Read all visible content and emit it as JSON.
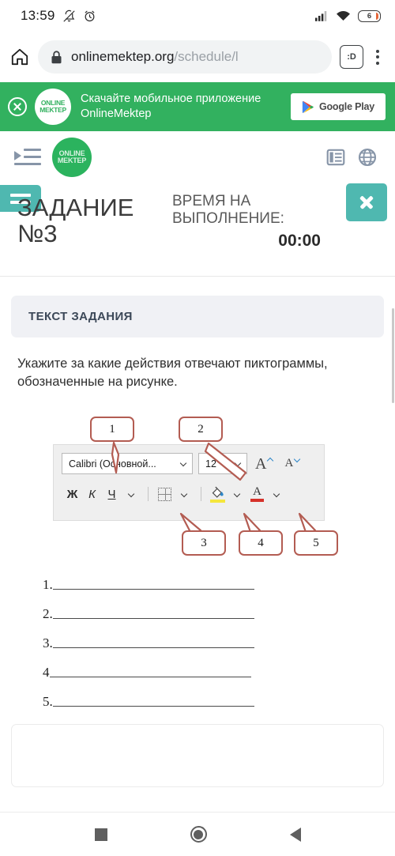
{
  "status_bar": {
    "time": "13:59",
    "icons": [
      "bell-off-icon",
      "alarm-icon",
      "signal-icon",
      "wifi-icon"
    ],
    "battery_level": "6"
  },
  "browser": {
    "home_icon": "home-icon",
    "lock_icon": "lock-icon",
    "url_domain": "onlinemektep.org",
    "url_path": "/schedule/l",
    "dino_label": ":D",
    "menu_icon": "kebab-menu-icon"
  },
  "promo_banner": {
    "close_icon": "close-circle-icon",
    "logo_line1": "ONLINE",
    "logo_line2": "MEKTEP",
    "text_line1": "Скачайте мобильное приложение",
    "text_line2": "OnlineMektep",
    "store_button": "Google Play",
    "bg_color": "#32b15f"
  },
  "site_nav": {
    "toggle_icon": "sidebar-toggle-icon",
    "logo_line1": "ONLINE",
    "logo_line2": "MEKTEP",
    "list_icon": "list-icon",
    "globe_icon": "globe-icon",
    "logo_color": "#2bb35e"
  },
  "task_header": {
    "burger_icon": "hamburger-menu-icon",
    "title_line1": "ЗАДАНИЕ",
    "title_line2": "№3",
    "timer_label_line1": "ВРЕМЯ НА",
    "timer_label_line2": "ВЫПОЛНЕНИЕ:",
    "timer_value": "00:00",
    "close_icon": "close-icon",
    "accent_color": "#4fb8b0"
  },
  "content": {
    "section_header": "ТЕКСТ ЗАДАНИЯ",
    "task_text": "Укажите за какие действия отвечают пиктограммы, обозначенные на рисунке.",
    "figure": {
      "font_select_value": "Calibri (Основной...",
      "size_select_value": "12",
      "grow_font_icon": "increase-font-size-icon",
      "shrink_font_icon": "decrease-font-size-icon",
      "bold_label": "Ж",
      "italic_label": "К",
      "underline_label": "Ч",
      "borders_icon": "borders-icon",
      "fill_color_icon": "fill-color-icon",
      "font_color_icon": "font-color-icon",
      "font_color_letter": "A",
      "callouts": [
        {
          "number": "1"
        },
        {
          "number": "2"
        },
        {
          "number": "3"
        },
        {
          "number": "4"
        },
        {
          "number": "5"
        }
      ],
      "callout_border_color": "#b35c52"
    },
    "answer_lines": [
      {
        "label": "1."
      },
      {
        "label": "2."
      },
      {
        "label": "3."
      },
      {
        "label": "4"
      },
      {
        "label": "5."
      }
    ]
  },
  "android_nav": {
    "recents_icon": "square-recents-icon",
    "home_icon": "circle-home-icon",
    "back_icon": "triangle-back-icon"
  }
}
